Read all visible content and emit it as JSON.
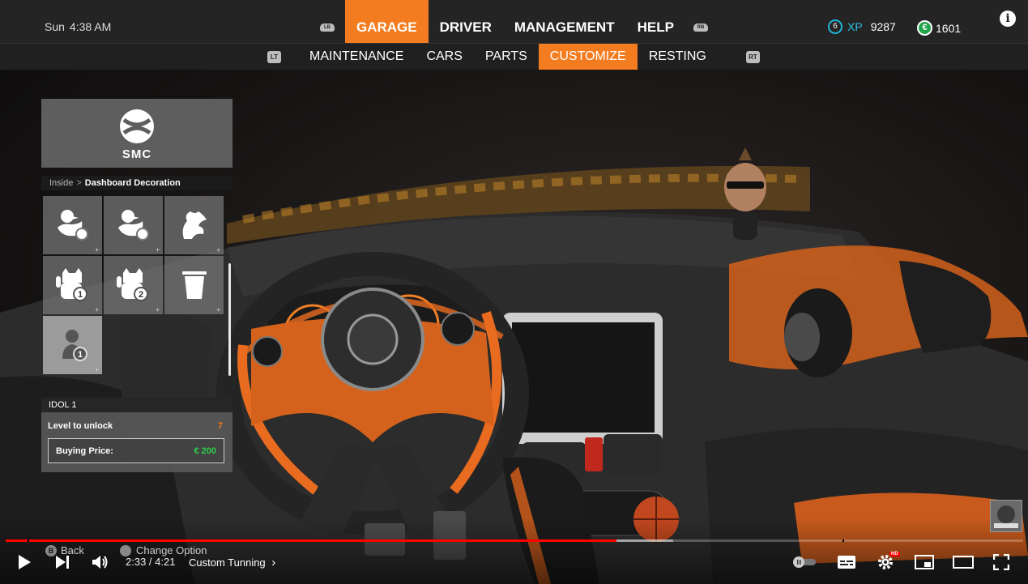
{
  "topbar": {
    "day": "Sun",
    "time": "4:38 AM",
    "lb_label": "LB",
    "rb_label": "RB",
    "tabs": [
      {
        "label": "GARAGE",
        "active": true
      },
      {
        "label": "DRIVER",
        "active": false
      },
      {
        "label": "MANAGEMENT",
        "active": false
      },
      {
        "label": "HELP",
        "active": false
      }
    ],
    "xp_level": "6",
    "xp_label": "XP",
    "xp_value": "9287",
    "money_symbol": "€",
    "money_value": "1601",
    "info_label": "i"
  },
  "subtabs": {
    "lt_label": "LT",
    "rt_label": "RT",
    "items": [
      {
        "label": "MAINTENANCE",
        "active": false
      },
      {
        "label": "CARS",
        "active": false
      },
      {
        "label": "PARTS",
        "active": false
      },
      {
        "label": "CUSTOMIZE",
        "active": true
      },
      {
        "label": "RESTING",
        "active": false
      }
    ]
  },
  "panel": {
    "brand_name": "SMC",
    "breadcrumb": {
      "parent": "Inside",
      "separator": ">",
      "current": "Dashboard Decoration"
    },
    "tiles": [
      {
        "icon": "duck-icon",
        "badge": "",
        "selected": false
      },
      {
        "icon": "duck-crown-icon",
        "badge": "",
        "selected": false
      },
      {
        "icon": "dragon-icon",
        "badge": "",
        "selected": false
      },
      {
        "icon": "lucky-cat-icon",
        "badge": "1",
        "selected": false
      },
      {
        "icon": "lucky-cat-icon",
        "badge": "2",
        "selected": false
      },
      {
        "icon": "trash-icon",
        "badge": "",
        "selected": false
      },
      {
        "icon": "idol-icon",
        "badge": "1",
        "selected": true
      }
    ],
    "detail": {
      "title": "IDOL 1",
      "level_label": "Level to unlock",
      "level_value": "7",
      "price_label": "Buying Price:",
      "price_value": "€ 200"
    }
  },
  "player": {
    "hint_back_key": "B",
    "hint_back": "Back",
    "hint_change": "Change Option",
    "current_time": "2:33",
    "duration": "4:21",
    "time_text": "2:33 / 4:21",
    "chapter": "Custom Tunning",
    "chapter_arrow": "›",
    "hd_badge": "HD",
    "progress_fraction": 0.6,
    "buffer_fraction": 0.656
  },
  "colors": {
    "accent": "#f47c20",
    "xp": "#2ec1e5",
    "money": "#1fa34a",
    "price": "#2bd14a",
    "progress": "#ff0000"
  }
}
